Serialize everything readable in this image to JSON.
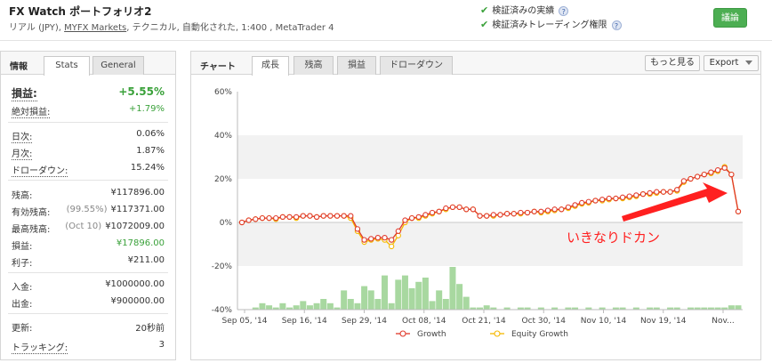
{
  "header": {
    "title": "FX Watch ポートフォリオ2",
    "sub_prefix": "リアル (JPY), ",
    "broker": "MYFX Markets",
    "sub_suffix": ", テクニカル, 自動化された, 1:400 , MetaTrader 4",
    "verified_track": "検証済みの実績",
    "verified_privileges": "検証済みトレーディング権限",
    "discuss_button": "議論"
  },
  "left_panel": {
    "section_label": "情報",
    "tabs": [
      "Stats",
      "General"
    ],
    "stats": {
      "gain_label": "損益:",
      "gain_value": "+5.55%",
      "abs_gain_label": "絶対損益:",
      "abs_gain_value": "+1.79%",
      "daily_label": "日次:",
      "daily_value": "0.06%",
      "monthly_label": "月次:",
      "monthly_value": "1.87%",
      "drawdown_label": "ドローダウン:",
      "drawdown_value": "15.24%",
      "balance_label": "残高:",
      "balance_value": "¥117896.00",
      "equity_label": "有効残高:",
      "equity_note": "(99.55%)",
      "equity_value": "¥117371.00",
      "highest_label": "最高残高:",
      "highest_note": "(Oct 10)",
      "highest_value": "¥1072009.00",
      "profit_label": "損益:",
      "profit_value": "¥17896.00",
      "interest_label": "利子:",
      "interest_value": "¥211.00",
      "deposits_label": "入金:",
      "deposits_value": "¥1000000.00",
      "withdrawals_label": "出金:",
      "withdrawals_value": "¥900000.00",
      "updated_label": "更新:",
      "updated_value": "20秒前",
      "tracking_label": "トラッキング:",
      "tracking_value": "3"
    }
  },
  "right_panel": {
    "section_label": "チャート",
    "tabs": [
      "成長",
      "残高",
      "損益",
      "ドローダウン"
    ],
    "more_button": "もっと見る",
    "export_button": "Export",
    "annotation": "いきなりドカン"
  },
  "colors": {
    "growth": "#e0392b",
    "equity": "#f5b800",
    "volume": "#a8d8a0",
    "annotation": "#ff2020",
    "accent_green": "#4cae52"
  },
  "chart_data": {
    "type": "line",
    "ylim": [
      -40,
      60
    ],
    "yticks": [
      "60%",
      "40%",
      "20%",
      "0%",
      "-20%",
      "-40%"
    ],
    "x_labels": [
      "Sep 05, '14",
      "Sep 16, '14",
      "Sep 29, '14",
      "Oct 08, '14",
      "Oct 21, '14",
      "Oct 30, '14",
      "Nov 10, '14",
      "Nov 19, '14",
      "Nov..."
    ],
    "series": [
      {
        "name": "Growth",
        "values": [
          0,
          1,
          1.5,
          2,
          2,
          2,
          2.5,
          2.5,
          2.5,
          3,
          3,
          2.5,
          3,
          3,
          3,
          3,
          3,
          -3,
          -8,
          -7.5,
          -7,
          -7,
          -8,
          -4,
          1,
          2,
          2.5,
          3.5,
          4.5,
          5,
          6.5,
          7,
          7,
          6,
          6,
          3,
          3,
          3.5,
          3.5,
          4,
          4,
          4.5,
          4.5,
          5,
          5,
          5.5,
          6,
          6,
          7,
          8,
          9,
          9.5,
          10,
          10.5,
          11,
          11,
          11.5,
          12,
          12.5,
          13,
          13.5,
          14,
          14,
          14,
          15,
          19,
          20,
          21,
          22,
          23,
          24,
          25,
          22,
          5
        ]
      },
      {
        "name": "Equity Growth",
        "values": [
          0,
          1,
          1.5,
          2,
          2,
          1.5,
          2.5,
          2.5,
          2,
          3,
          3,
          2.5,
          3,
          3,
          3,
          3,
          2,
          -4,
          -9,
          -8,
          -7.5,
          -8,
          -11,
          -6,
          0,
          2,
          2,
          3,
          4,
          5,
          6,
          7,
          7,
          6,
          6,
          3,
          3,
          3,
          3.5,
          4,
          4,
          4,
          4.5,
          5,
          4.5,
          5,
          5.5,
          6,
          6.5,
          7.5,
          8.5,
          9,
          10,
          10,
          10.5,
          11,
          11,
          11.5,
          12,
          13,
          13,
          13.5,
          14,
          14,
          14.5,
          18.5,
          20,
          21,
          22,
          22.5,
          23.5,
          25.5,
          22,
          5
        ]
      }
    ],
    "volume": [
      0,
      0,
      1,
      3,
      2,
      1,
      3,
      1,
      2,
      4,
      2,
      3,
      5,
      3,
      1,
      9,
      5,
      3,
      11,
      9,
      5,
      16,
      3,
      14,
      16,
      10,
      13,
      15,
      4,
      9,
      5,
      20,
      12,
      6,
      1,
      1,
      2,
      1,
      0,
      1,
      0,
      1,
      1,
      0,
      1,
      0,
      1,
      0,
      1,
      1,
      0,
      1,
      0,
      1,
      0,
      1,
      1,
      0,
      1,
      0,
      1,
      1,
      0,
      1,
      1,
      0,
      1,
      1,
      1,
      1,
      1,
      1,
      2,
      2
    ]
  }
}
